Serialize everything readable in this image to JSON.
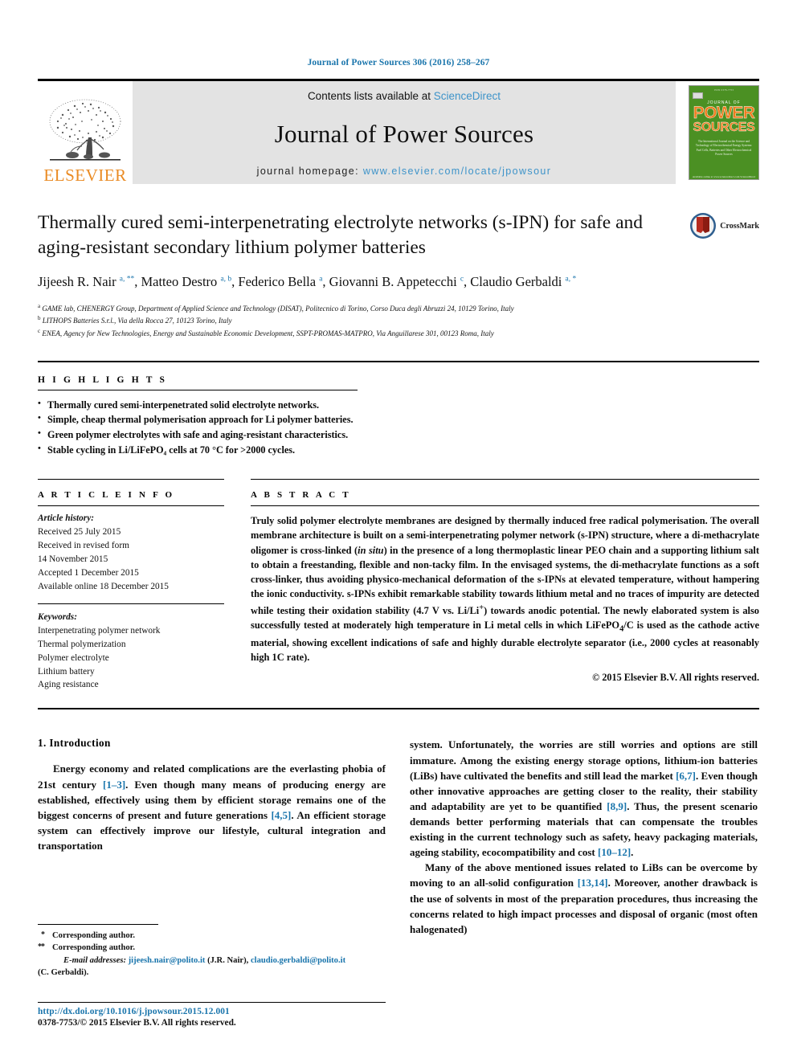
{
  "running_head": "Journal of Power Sources 306 (2016) 258–267",
  "masthead": {
    "publisher_logo_text": "ELSEVIER",
    "contents_prefix": "Contents lists available at ",
    "contents_link": "ScienceDirect",
    "journal_name": "Journal of Power Sources",
    "homepage_prefix": "journal homepage: ",
    "homepage_url": "www.elsevier.com/locate/jpowsour",
    "cover": {
      "top_note": "ISSN 0378-7753",
      "line1": "JOURNAL OF",
      "line2": "POWER",
      "line3": "SOURCES",
      "subtitle": "The International Journal on the Science and Technology of Electrochemical Energy Systems: Fuel Cells, Batteries and Other Electrochemical Power Sources",
      "footer": "Available online at www.sciencedirect.com  ScienceDirect"
    },
    "link_color": "#3d93c9",
    "band_color": "#e3e3e3",
    "cover_color": "#4b9023",
    "cover_accent": "#f07c1d",
    "elsevier_orange": "#ea8b24"
  },
  "article": {
    "title": "Thermally cured semi-interpenetrating electrolyte networks (s-IPN) for safe and aging-resistant secondary lithium polymer batteries",
    "crossmark_label": "CrossMark",
    "authors_html": "Jijeesh R. Nair <sup>a, **</sup>, Matteo Destro <sup>a, b</sup>, Federico Bella <sup>a</sup>, Giovanni B. Appetecchi <sup>c</sup>, Claudio Gerbaldi <sup>a, *</sup>",
    "affiliations": [
      {
        "mark": "a",
        "text": "GAME lab, CHENERGY Group, Department of Applied Science and Technology (DISAT), Politecnico di Torino, Corso Duca degli Abruzzi 24, 10129 Torino, Italy"
      },
      {
        "mark": "b",
        "text": "LITHOPS Batteries S.r.l., Via della Rocca 27, 10123 Torino, Italy"
      },
      {
        "mark": "c",
        "text": "ENEA, Agency for New Technologies, Energy and Sustainable Economic Development, SSPT-PROMAS-MATPRO, Via Anguillarese 301, 00123 Roma, Italy"
      }
    ]
  },
  "highlights": {
    "heading": "H I G H L I G H T S",
    "items": [
      "Thermally cured semi-interpenetrated solid electrolyte networks.",
      "Simple, cheap thermal polymerisation approach for Li polymer batteries.",
      "Green polymer electrolytes with safe and aging-resistant characteristics.",
      "Stable cycling in Li/LiFePO₄ cells at 70 °C for >2000 cycles."
    ]
  },
  "article_info": {
    "heading": "A R T I C L E   I N F O",
    "history_label": "Article history:",
    "history": [
      "Received 25 July 2015",
      "Received in revised form",
      "14 November 2015",
      "Accepted 1 December 2015",
      "Available online 18 December 2015"
    ],
    "keywords_label": "Keywords:",
    "keywords": [
      "Interpenetrating polymer network",
      "Thermal polymerization",
      "Polymer electrolyte",
      "Lithium battery",
      "Aging resistance"
    ]
  },
  "abstract": {
    "heading": "A B S T R A C T",
    "text_html": "Truly solid polymer electrolyte membranes are designed by thermally induced free radical polymerisation. The overall membrane architecture is built on a semi-interpenetrating polymer network (s-IPN) structure, where a di-methacrylate oligomer is cross-linked (<span class=\"ital\">in situ</span>) in the presence of a long thermoplastic linear PEO chain and a supporting lithium salt to obtain a freestanding, flexible and non-tacky film. In the envisaged systems, the di-methacrylate functions as a soft cross-linker, thus avoiding physico-mechanical deformation of the s-IPNs at elevated temperature, without hampering the ionic conductivity. s-IPNs exhibit remarkable stability towards lithium metal and no traces of impurity are detected while testing their oxidation stability (4.7 V vs. Li/Li<sup>+</sup>) towards anodic potential. The newly elaborated system is also successfully tested at moderately high temperature in Li metal cells in which LiFePO<sub>4</sub>/C is used as the cathode active material, showing excellent indications of safe and highly durable electrolyte separator (i.e., 2000 cycles at reasonably high 1C rate).",
    "copyright": "© 2015 Elsevier B.V. All rights reserved."
  },
  "body": {
    "section_number_title": "1.  Introduction",
    "left_paragraph_html": "Energy economy and related complications are the everlasting phobia of 21st century <span class=\"ref\">[1–3]</span>. Even though many means of producing energy are established, effectively using them by efficient storage remains one of the biggest concerns of present and future generations <span class=\"ref\">[4,5]</span>. An efficient storage system can effectively improve our lifestyle, cultural integration and transportation",
    "right_paragraph1_html": "system. Unfortunately, the worries are still worries and options are still immature. Among the existing energy storage options, lithium-ion batteries (LiBs) have cultivated the benefits and still lead the market <span class=\"ref\">[6,7]</span>. Even though other innovative approaches are getting closer to the reality, their stability and adaptability are yet to be quantified <span class=\"ref\">[8,9]</span>. Thus, the present scenario demands better performing materials that can compensate the troubles existing in the current technology such as safety, heavy packaging materials, ageing stability, ecocompatibility and cost <span class=\"ref\">[10–12]</span>.",
    "right_paragraph2_html": "Many of the above mentioned issues related to LiBs can be overcome by moving to an all-solid configuration <span class=\"ref\">[13,14]</span>. Moreover, another drawback is the use of solvents in most of the preparation procedures, thus increasing the concerns related to high impact processes and disposal of organic (most often halogenated)"
  },
  "footnotes": {
    "corresponding_single": "Corresponding author.",
    "corresponding_double": "Corresponding author.",
    "email_label": "E-mail addresses:",
    "email1": "jijeesh.nair@polito.it",
    "email1_owner": "(J.R. Nair),",
    "email2": "claudio.gerbaldi@polito.it",
    "email2_owner": "(C. Gerbaldi).",
    "doi": "http://dx.doi.org/10.1016/j.jpowsour.2015.12.001",
    "issn_line": "0378-7753/© 2015 Elsevier B.V. All rights reserved."
  }
}
